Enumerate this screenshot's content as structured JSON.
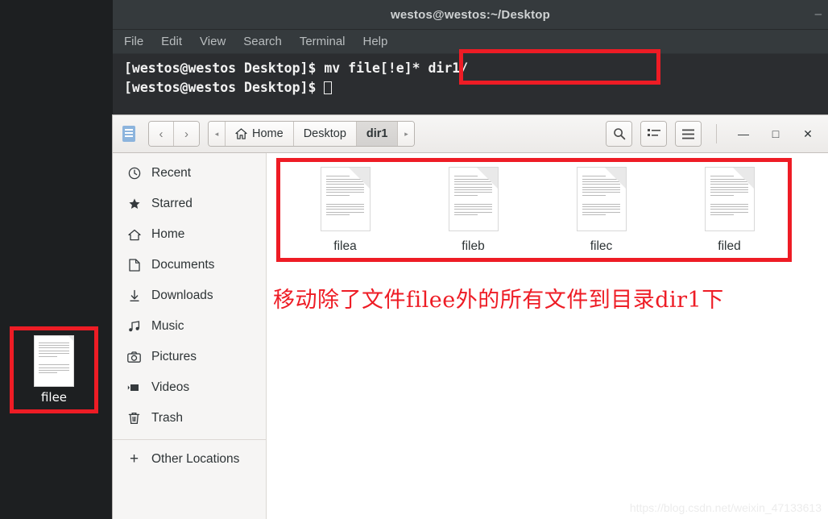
{
  "desktop": {
    "file": {
      "name": "filee",
      "icon": "document-icon"
    },
    "highlight_color": "#ee1c25",
    "background_color": "#1d1f21"
  },
  "terminal": {
    "title": "westos@westos:~/Desktop",
    "minimize_glyph": "—",
    "menu": [
      "File",
      "Edit",
      "View",
      "Search",
      "Terminal",
      "Help"
    ],
    "lines": [
      {
        "prompt": "[westos@westos Desktop]$ ",
        "command": "mv file[!e]* dir1/"
      },
      {
        "prompt": "[westos@westos Desktop]$ ",
        "command": ""
      }
    ],
    "background_color": "#2b2d30",
    "text_color": "#f2f2f2"
  },
  "files": {
    "header": {
      "app_icon": "documents-icon",
      "back_glyph": "‹",
      "forward_glyph": "›",
      "crumb_left_glyph": "◂",
      "crumb_right_glyph": "▸",
      "search_glyph": "⌕",
      "view_list_glyph": "☰",
      "menu_glyph": "☰",
      "minimize_glyph": "—",
      "maximize_glyph": "□",
      "close_glyph": "✕"
    },
    "breadcrumb": [
      {
        "label": "Home",
        "icon": "home-icon",
        "active": false
      },
      {
        "label": "Desktop",
        "icon": "",
        "active": false
      },
      {
        "label": "dir1",
        "icon": "",
        "active": true
      }
    ],
    "sidebar": [
      {
        "label": "Recent",
        "icon": "clock-icon",
        "glyph": "◴"
      },
      {
        "label": "Starred",
        "icon": "star-icon",
        "glyph": "★"
      },
      {
        "label": "Home",
        "icon": "home-icon",
        "glyph": "⌂"
      },
      {
        "label": "Documents",
        "icon": "document-icon",
        "glyph": "὜b"
      },
      {
        "label": "Downloads",
        "icon": "download-icon",
        "glyph": "⤓"
      },
      {
        "label": "Music",
        "icon": "music-icon",
        "glyph": "♫"
      },
      {
        "label": "Pictures",
        "icon": "camera-icon",
        "glyph": "◎"
      },
      {
        "label": "Videos",
        "icon": "video-icon",
        "glyph": "▶"
      },
      {
        "label": "Trash",
        "icon": "trash-icon",
        "glyph": "Ὕ1"
      }
    ],
    "other_locations": {
      "label": "Other Locations",
      "icon": "plus-icon",
      "glyph": "+"
    },
    "items": [
      {
        "name": "filea",
        "icon": "document-icon"
      },
      {
        "name": "fileb",
        "icon": "document-icon"
      },
      {
        "name": "filec",
        "icon": "document-icon"
      },
      {
        "name": "filed",
        "icon": "document-icon"
      }
    ]
  },
  "annotation": {
    "text": "移动除了文件filee外的所有文件到目录dir1下",
    "color": "#ee1c25"
  },
  "watermark": {
    "text": "https://blog.csdn.net/weixin_47133613"
  }
}
